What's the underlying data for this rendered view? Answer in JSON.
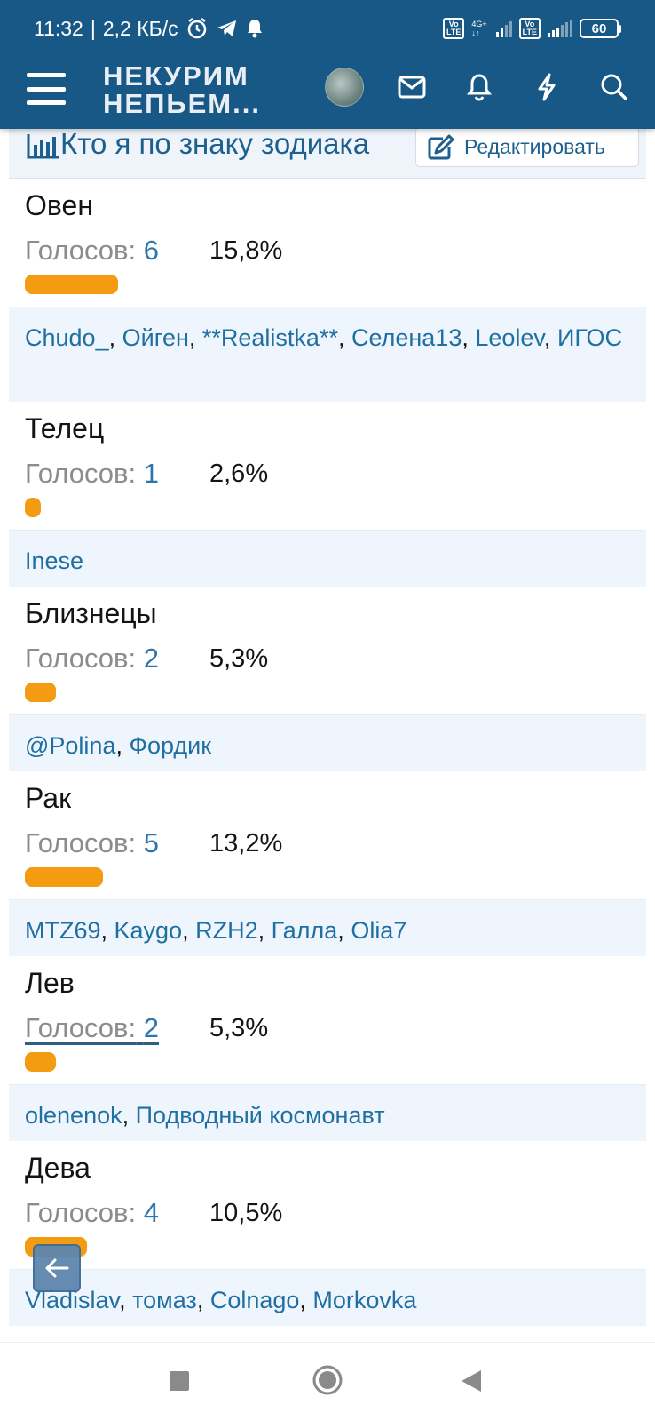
{
  "status_bar": {
    "time": "11:32",
    "net_speed": "2,2 КБ/с",
    "battery": "60",
    "volte": "Vo\nLTE",
    "network": "4G+"
  },
  "header": {
    "logo_line1": "НЕКУРИМ",
    "logo_line2": "НЕПЬЕМ..."
  },
  "thread": {
    "title": "Кто я по знаку зодиака",
    "edit_label": "Редактировать"
  },
  "poll": {
    "votes_label": "Голосов:",
    "options": [
      {
        "name": "Овен",
        "votes": "6",
        "percent": "15,8%",
        "fill": 15.8,
        "voters": [
          "Chudo_",
          "Ойген",
          "**Realistka**",
          "Селена13",
          "Leolev",
          "ИГОС"
        ]
      },
      {
        "name": "Телец",
        "votes": "1",
        "percent": "2,6%",
        "fill": 2.6,
        "voters": [
          "Inese"
        ]
      },
      {
        "name": "Близнецы",
        "votes": "2",
        "percent": "5,3%",
        "fill": 5.3,
        "voters": [
          "@Polina",
          "Фордик"
        ]
      },
      {
        "name": "Рак",
        "votes": "5",
        "percent": "13,2%",
        "fill": 13.2,
        "voters": [
          "MTZ69",
          "Kaygo",
          "RZH2",
          "Галла",
          "Olia7"
        ]
      },
      {
        "name": "Лев",
        "votes": "2",
        "percent": "5,3%",
        "fill": 5.3,
        "voters": [
          "olenenok",
          "Подводный космонавт"
        ]
      },
      {
        "name": "Дева",
        "votes": "4",
        "percent": "10,5%",
        "fill": 10.5,
        "voters": [
          "Vladislav",
          "томаз",
          "Colnago",
          "Morkovka"
        ]
      }
    ]
  },
  "colors": {
    "header_bg": "#185886",
    "link": "#1f6fa3",
    "bar": "#f39c12",
    "voters_bg": "#eef5fc"
  },
  "icons": {
    "menu": "hamburger-menu-icon",
    "mail": "envelope-icon",
    "bell": "bell-icon",
    "flash": "lightning-icon",
    "search": "search-icon",
    "chart": "bar-chart-icon",
    "edit": "edit-icon",
    "back": "arrow-left-icon"
  }
}
